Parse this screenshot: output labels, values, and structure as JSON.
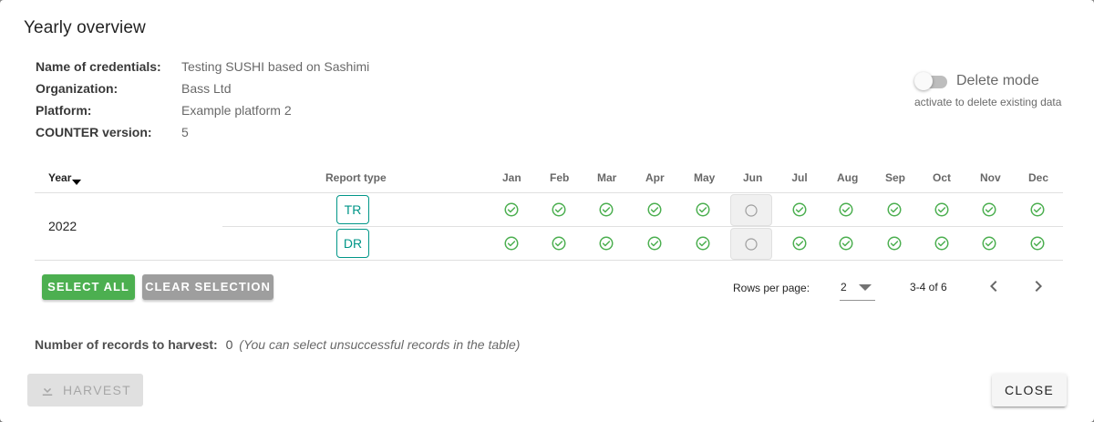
{
  "dialog": {
    "title": "Yearly overview"
  },
  "info": {
    "rows": [
      {
        "label": "Name of credentials:",
        "value": "Testing SUSHI based on Sashimi"
      },
      {
        "label": "Organization:",
        "value": "Bass Ltd"
      },
      {
        "label": "Platform:",
        "value": "Example platform 2"
      },
      {
        "label": "COUNTER version:",
        "value": "5"
      }
    ]
  },
  "delete_mode": {
    "label": "Delete mode",
    "hint": "activate to delete existing data",
    "enabled": false
  },
  "table": {
    "headers": {
      "year": "Year",
      "report_type": "Report type",
      "months": [
        "Jan",
        "Feb",
        "Mar",
        "Apr",
        "May",
        "Jun",
        "Jul",
        "Aug",
        "Sep",
        "Oct",
        "Nov",
        "Dec"
      ]
    },
    "year": "2022",
    "rows": [
      {
        "report_type": "TR",
        "status": [
          "success",
          "success",
          "success",
          "success",
          "success",
          "empty",
          "success",
          "success",
          "success",
          "success",
          "success",
          "success"
        ]
      },
      {
        "report_type": "DR",
        "status": [
          "success",
          "success",
          "success",
          "success",
          "success",
          "empty",
          "success",
          "success",
          "success",
          "success",
          "success",
          "success"
        ]
      }
    ]
  },
  "actions": {
    "select_all": "SELECT ALL",
    "clear_selection": "CLEAR SELECTION"
  },
  "pagination": {
    "rows_per_page_label": "Rows per page:",
    "rows_per_page_value": "2",
    "range": "3-4 of 6"
  },
  "records": {
    "label": "Number of records to harvest:",
    "count": "0",
    "hint": "(You can select unsuccessful records in the table)"
  },
  "footer": {
    "harvest": "HARVEST",
    "close": "CLOSE"
  },
  "colors": {
    "success": "#4caf50",
    "chip": "#009688",
    "select_all": "#4caf50",
    "clear_selection": "#9e9e9e"
  },
  "icons": {
    "status_success": "check-circle-icon",
    "status_empty": "empty-circle-icon",
    "harvest": "download-icon",
    "prev": "chevron-left-icon",
    "next": "chevron-right-icon",
    "sort": "sort-down-icon"
  }
}
